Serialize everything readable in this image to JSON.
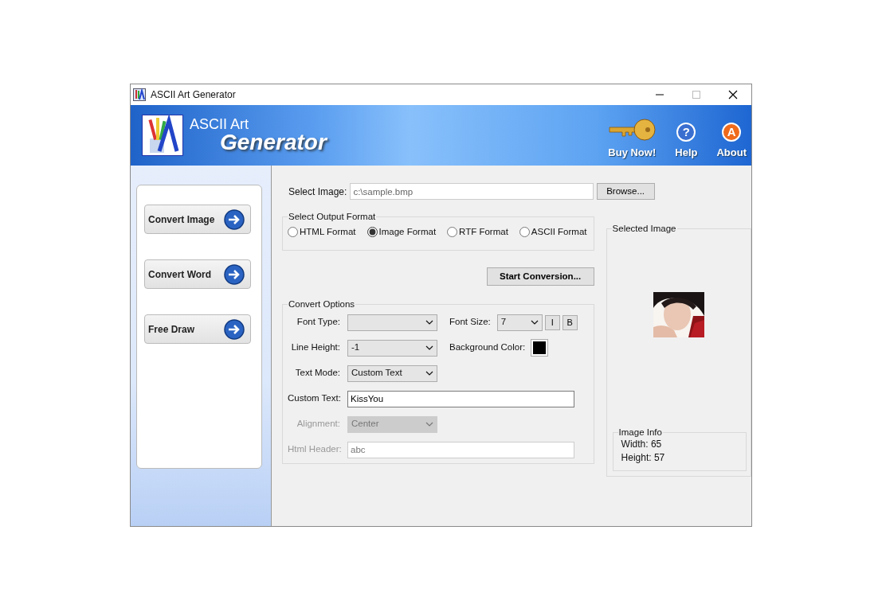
{
  "window": {
    "title": "ASCII Art Generator"
  },
  "header": {
    "title_line1": "ASCII Art",
    "title_line2": "Generator",
    "actions": [
      {
        "kind": "key",
        "label": "Buy Now!"
      },
      {
        "kind": "badge",
        "glyph": "?",
        "label": "Help",
        "color": "#3a6fd0"
      },
      {
        "kind": "badge",
        "glyph": "A",
        "label": "About",
        "color": "#f06a1c"
      }
    ]
  },
  "sidebar": {
    "items": [
      {
        "label": "Convert Image"
      },
      {
        "label": "Convert Word"
      },
      {
        "label": "Free Draw"
      }
    ]
  },
  "select_image": {
    "label": "Select Image:",
    "value": "c:\\sample.bmp",
    "button": "Browse..."
  },
  "output_format": {
    "legend": "Select Output Format",
    "options": [
      {
        "label": "HTML Format",
        "selected": false
      },
      {
        "label": "Image Format",
        "selected": true
      },
      {
        "label": "RTF Format",
        "selected": false
      },
      {
        "label": "ASCII Format",
        "selected": false
      }
    ]
  },
  "start_button": "Start Conversion...",
  "convert_options": {
    "legend": "Convert Options",
    "rows": [
      [
        {
          "kind": "select",
          "label": "Font Type:",
          "disabled": false
        },
        {
          "kind": "select",
          "label": "Font Size:",
          "value": "7",
          "disabled": false
        },
        {
          "kind": "toggle",
          "value": "I"
        },
        {
          "kind": "toggle",
          "value": "B"
        }
      ],
      [
        {
          "kind": "select",
          "label": "Line Height:",
          "value": "-1",
          "disabled": false
        },
        {
          "kind": "swatch",
          "label": "Background Color:",
          "color": "#000000"
        }
      ],
      [
        {
          "kind": "select",
          "label": "Text Mode:",
          "value": "Custom Text",
          "disabled": false
        }
      ],
      [
        {
          "kind": "input",
          "label": "Custom Text:",
          "value": "KissYou",
          "disabled": false
        }
      ],
      [
        {
          "kind": "select",
          "label": "Alignment:",
          "value": "Center",
          "disabled": true
        }
      ],
      [
        {
          "kind": "input",
          "label": "Html Header:",
          "value": "abc",
          "disabled": true
        }
      ]
    ]
  },
  "selected_image": {
    "legend": "Selected Image",
    "info": {
      "legend": "Image Info",
      "lines": [
        "Width: 65",
        "Height: 57"
      ]
    }
  }
}
